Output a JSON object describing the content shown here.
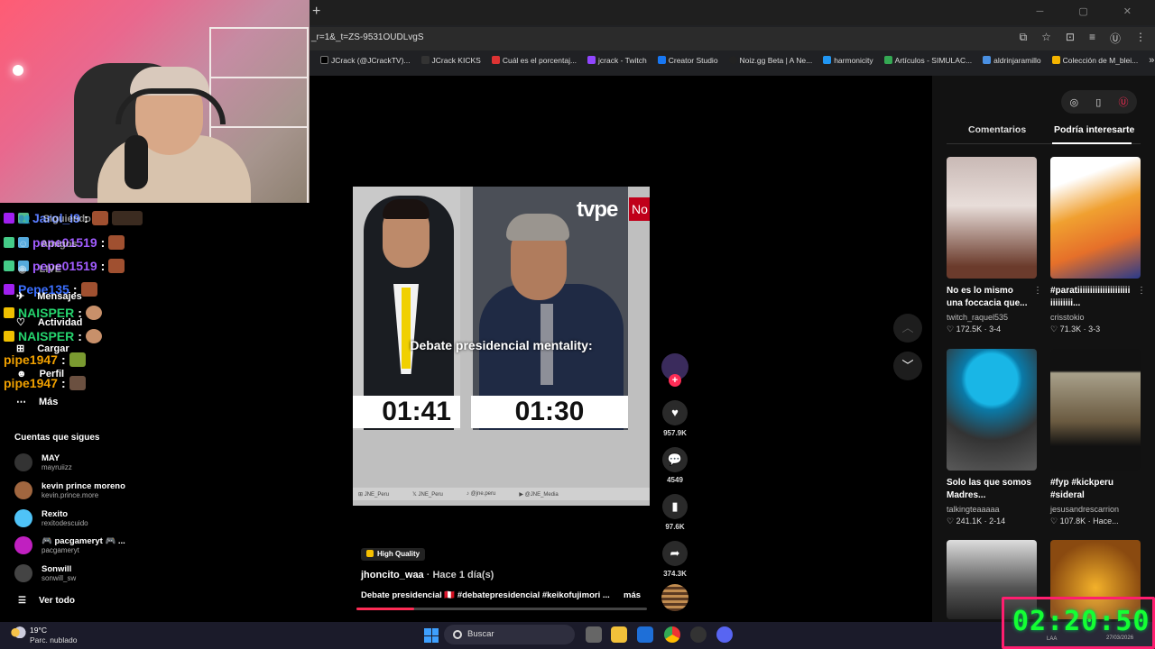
{
  "browser": {
    "url": "_r=1&_t=ZS-9531OUDLvgS",
    "bookmarks": [
      "JCrack (@JCrackTV)...",
      "JCrack KICKS",
      "Cuál es el porcentaj...",
      "jcrack - Twitch",
      "Creator Studio",
      "Noiz.gg Beta | A Ne...",
      "harmonicity",
      "Artículos - SIMULAC...",
      "aldrinjaramillo",
      "Colección de M_blei..."
    ],
    "overflow": "»",
    "new_tab": "+"
  },
  "chat": [
    {
      "user": "Jarol_I9",
      "color": "#5a7dff",
      "sep": ":"
    },
    {
      "user": "pepe01519",
      "color": "#a15cff",
      "sep": ":"
    },
    {
      "user": "pepe01519",
      "color": "#a15cff",
      "sep": ":"
    },
    {
      "user": "Pepe135",
      "color": "#3b6fff",
      "sep": ":"
    },
    {
      "user": "NAISPER",
      "color": "#25d36d",
      "sep": ":"
    },
    {
      "user": "NAISPER",
      "color": "#25d36d",
      "sep": ":"
    },
    {
      "user": "pipe1947",
      "color": "#f0a000",
      "sep": ":"
    },
    {
      "user": "pipe1947",
      "color": "#f0a000",
      "sep": ":"
    }
  ],
  "nav": {
    "following": "Siguiendo",
    "friends": "Amigos",
    "live": "LIVE",
    "messages": "Mensajes",
    "activity": "Actividad",
    "upload": "Cargar",
    "profile": "Perfil",
    "more": "Más",
    "followed_title": "Cuentas que sigues",
    "see_all": "Ver todo"
  },
  "followed": [
    {
      "name": "MAY",
      "handle": "mayruiizz",
      "color": "#333"
    },
    {
      "name": "kevin prince moreno",
      "handle": "kevin.prince.more",
      "color": "#a0663f"
    },
    {
      "name": "Rexito",
      "handle": "rexitodescuido",
      "color": "#4fc3f7"
    },
    {
      "name": "🎮 pacgameryt 🎮 ...",
      "handle": "pacgameryt",
      "color": "#c020c0"
    },
    {
      "name": "Sonwill",
      "handle": "sonwill_sw",
      "color": "#444"
    }
  ],
  "video": {
    "overlay": "Debate presidencial mentality:",
    "channel_logo": "tvpe",
    "tag": "No",
    "timer_left": "01:41",
    "timer_right": "01:30",
    "footer": [
      "⊞ JNE_Peru",
      "𝕏 JNE_Peru",
      "♪ @jne.peru",
      "▶ @JNE_Media"
    ],
    "progress": 0.2,
    "badge": "High Quality",
    "author": "jhoncito_waa",
    "age": "Hace 1 día(s)",
    "description": "Debate presidencial 🇵🇪 #debatepresidencial #keikofujimori ...",
    "more": "más",
    "likes": "957.9K",
    "comments": "4549",
    "saves": "97.6K",
    "shares": "374.3K"
  },
  "sidebar": {
    "tab_comments": "Comentarios",
    "tab_interest": "Podría interesarte",
    "cards": [
      {
        "title": "No es lo mismo una foccacia que...",
        "user": "twitch_raquel535",
        "likes": "172.5K",
        "date": "3-4"
      },
      {
        "title": "#paratiiiiiiiiiiiiiiiiiiiii iiiiiiiii...",
        "user": "crisstokio",
        "likes": "71.3K",
        "date": "3-3"
      },
      {
        "title": "Solo las que somos Madres...",
        "user": "talkingteaaaaa",
        "likes": "241.1K",
        "date": "2-14"
      },
      {
        "title": "#fyp #kickperu #sideral",
        "user": "jesusandrescarrion",
        "likes": "107.8K",
        "date": "Hace..."
      }
    ]
  },
  "taskbar": {
    "temp": "19°C",
    "weather": "Parc. nublado",
    "search": "Buscar"
  },
  "overlay_clock": {
    "time": "02:20:50",
    "date": "27/03/2026",
    "lang": "LAA"
  }
}
